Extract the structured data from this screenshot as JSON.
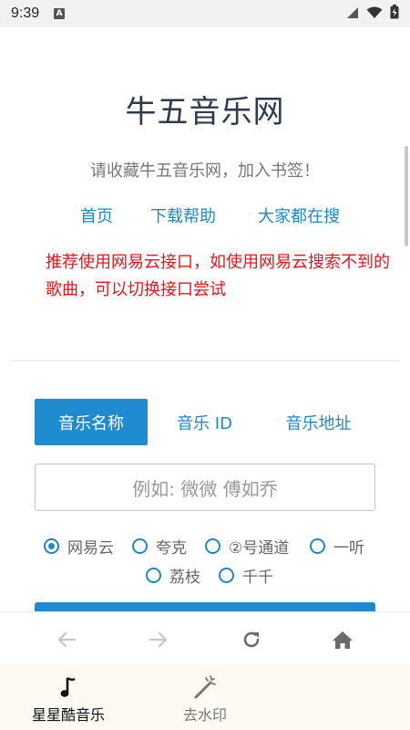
{
  "status_bar": {
    "time": "9:39",
    "notif_letter": "A"
  },
  "page": {
    "title": "牛五音乐网",
    "subtitle": "请收藏牛五音乐网，加入书签！",
    "nav": [
      "首页",
      "下载帮助",
      "大家都在搜"
    ],
    "notice": "推荐使用网易云接口，如使用网易云搜索不到的歌曲，可以切换接口尝试"
  },
  "tabs": {
    "active": "音乐名称",
    "id": "音乐 ID",
    "url": "音乐地址"
  },
  "search": {
    "placeholder": "例如: 微微 傅如乔"
  },
  "sources": {
    "row1": [
      "网易云",
      "夸克",
      "②号通道",
      "一听"
    ],
    "row2": [
      "荔枝",
      "千千"
    ],
    "selected": "网易云"
  },
  "toolbar": {
    "icons": [
      "back-arrow-icon",
      "forward-arrow-icon",
      "refresh-icon",
      "home-icon"
    ]
  },
  "bottom_nav": {
    "item1": "星星酷音乐",
    "item2": "去水印"
  },
  "colors": {
    "accent": "#1e8bd0",
    "notice": "#e8141a",
    "title": "#2e3a4d"
  }
}
